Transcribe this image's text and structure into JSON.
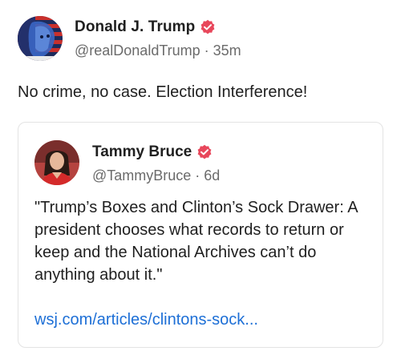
{
  "post": {
    "author_name": "Donald J. Trump",
    "handle_time": "@realDonaldTrump · 35m",
    "text": "No crime, no case. Election Interference!"
  },
  "quoted_post": {
    "author_name": "Tammy Bruce",
    "handle_time": "@TammyBruce · 6d",
    "text": "\"Trump’s Boxes and Clinton’s Sock Drawer: A president chooses what records to return or keep and the National Archives can’t do anything about it.\"",
    "link_text": "wsj.com/articles/clintons-sock..."
  },
  "icons": {
    "verified": "verified-badge-icon"
  },
  "colors": {
    "verified_badge": "#e8475b",
    "link": "#1d6fd6",
    "secondary_text": "#6b6b6b"
  }
}
